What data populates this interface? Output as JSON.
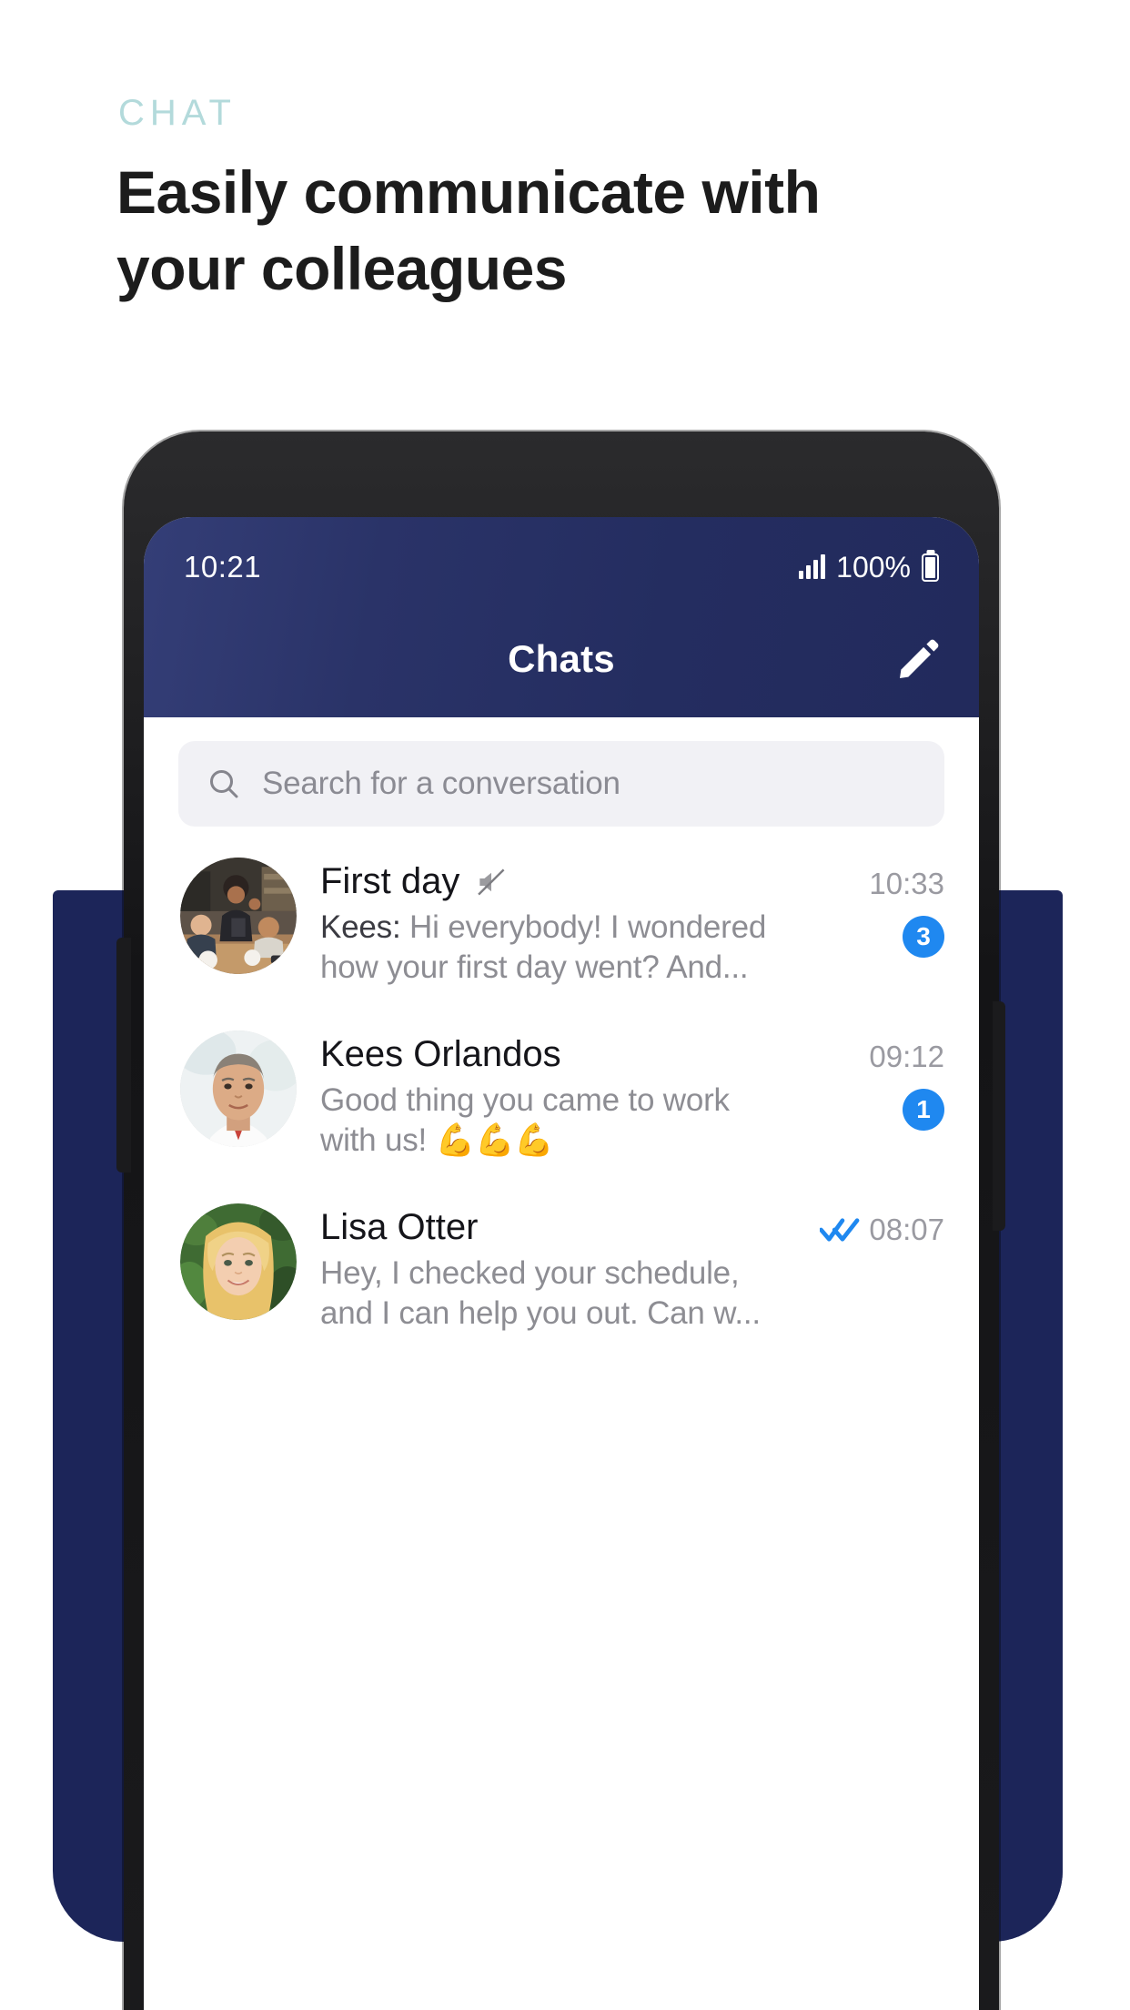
{
  "promo": {
    "eyebrow": "CHAT",
    "headline_line1": "Easily communicate with",
    "headline_line2": "your colleagues",
    "eyebrow_color": "#b3dadb",
    "headline_color": "#1c1c1c",
    "backdrop_color": "#1c2559"
  },
  "phone": {
    "status_bar": {
      "time": "10:21",
      "battery_percent": "100%",
      "signal_icon": "signal-bars-icon",
      "battery_icon": "battery-full-icon"
    },
    "nav_bar": {
      "title": "Chats",
      "compose_icon": "pencil-compose-icon",
      "background_color": "#242d60"
    },
    "search": {
      "placeholder": "Search for a conversation",
      "icon": "search-icon",
      "field_color": "#f1f1f5"
    },
    "accent_color": "#1f88f0",
    "chats": [
      {
        "name": "First day",
        "muted": true,
        "mute_icon": "speaker-muted-icon",
        "sender": "Kees:",
        "preview": "Hi everybody! I wondered how your first day went? And...",
        "time": "10:33",
        "unread": "3",
        "read_receipt": false,
        "avatar": "group-cafe-photo"
      },
      {
        "name": "Kees Orlandos",
        "muted": false,
        "sender": "",
        "preview": "Good thing you came to work with us! 💪💪💪",
        "time": "09:12",
        "unread": "1",
        "read_receipt": false,
        "avatar": "man-portrait-photo"
      },
      {
        "name": "Lisa Otter",
        "muted": false,
        "sender": "",
        "preview": "Hey, I checked your schedule, and I can help you out. Can w...",
        "time": "08:07",
        "unread": "",
        "read_receipt": true,
        "read_receipt_icon": "double-check-icon",
        "avatar": "woman-portrait-photo"
      }
    ]
  }
}
